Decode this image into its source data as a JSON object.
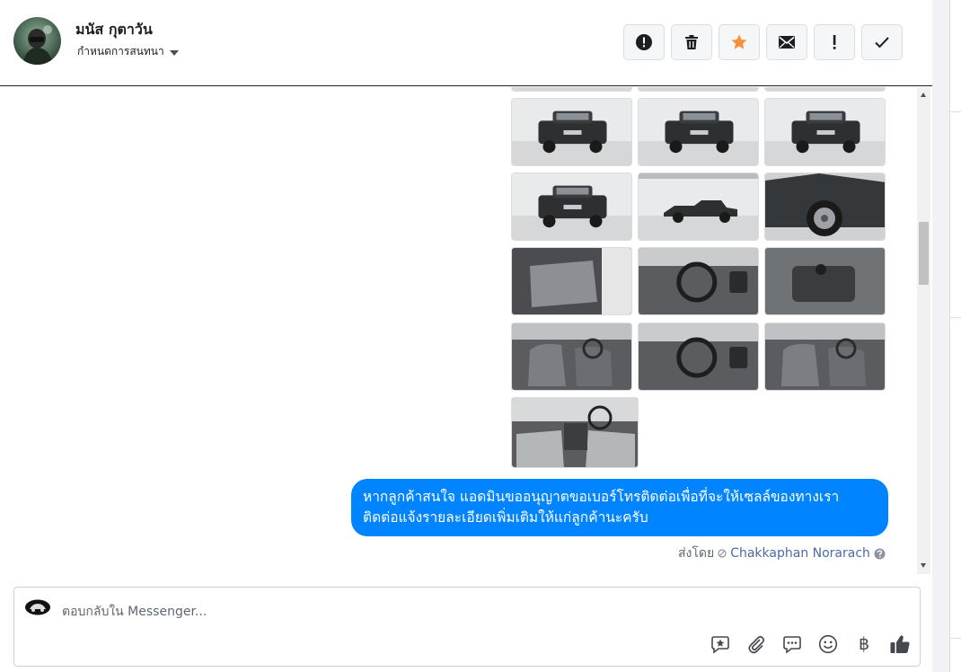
{
  "contact": {
    "name": "มนัส กุตาวัน",
    "label_dropdown": "กำหนดการสนทนา"
  },
  "actions": [
    {
      "name": "mark-spam-button",
      "icon": "alert-circle-icon"
    },
    {
      "name": "delete-button",
      "icon": "trash-icon"
    },
    {
      "name": "star-button",
      "icon": "star-icon",
      "color": "#f7923b"
    },
    {
      "name": "mark-unread-button",
      "icon": "envelope-icon"
    },
    {
      "name": "follow-up-button",
      "icon": "exclamation-icon"
    },
    {
      "name": "mark-done-button",
      "icon": "checkmark-icon"
    }
  ],
  "thread": {
    "photo_count": 16,
    "message": {
      "line1": "หากลูกค้าสนใจ แอดมินขออนุญาตขอเบอร์โทรติดต่อเพื่อที่จะให้เซลล์ของทางเรา",
      "line2": "ติดต่อแจ้งรายละเอียดเพิ่มเติมให้แก่ลูกค้านะครับ"
    },
    "sent_by_label": "ส่งโดย",
    "sender_name": "Chakkaphan Norarach",
    "bubble_color": "#0084ff"
  },
  "composer": {
    "placeholder": "ตอบกลับใน Messenger...",
    "tools": [
      "saved-reply-icon",
      "attachment-icon",
      "chat-bubbles-icon",
      "emoji-icon",
      "baht-icon",
      "thumbs-up-icon"
    ],
    "baht_symbol": "฿"
  }
}
